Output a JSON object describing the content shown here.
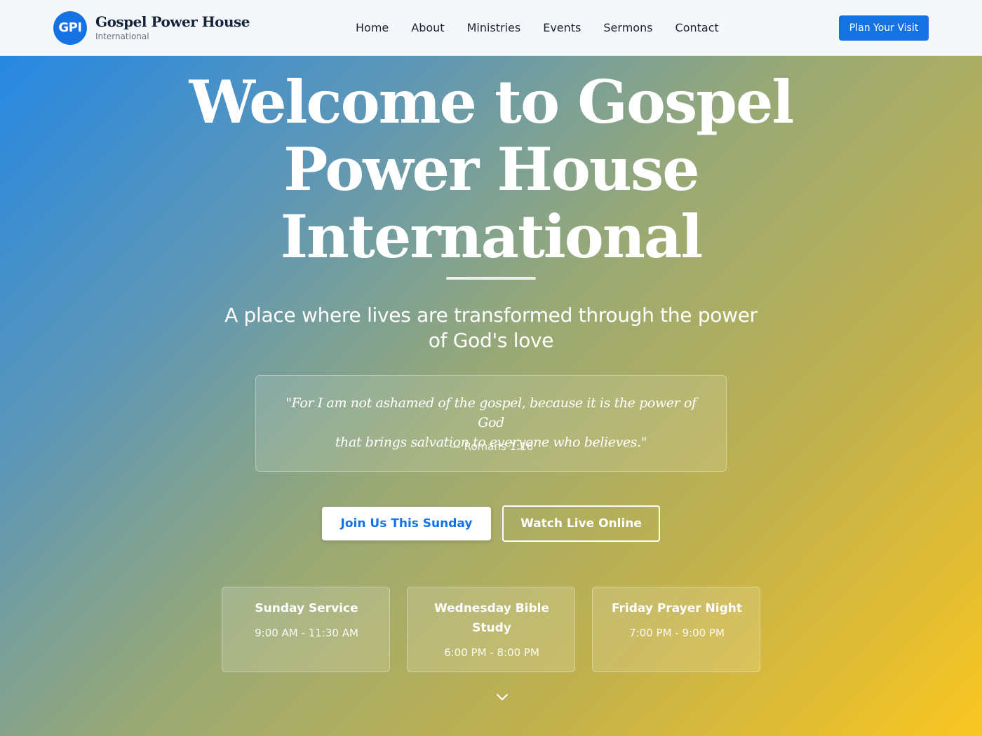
{
  "header": {
    "logo_text": "GPI",
    "brand_name": "Gospel Power House",
    "brand_sub": "International",
    "nav": [
      "Home",
      "About",
      "Ministries",
      "Events",
      "Sermons",
      "Contact"
    ],
    "cta_label": "Plan Your Visit"
  },
  "hero": {
    "title_line1": "Welcome to Gospel",
    "title_line2": "Power House",
    "title_line3": "International",
    "subtitle_line1": "A place where lives are transformed through the power",
    "subtitle_line2": "of God's love",
    "verse": {
      "line1": "\"For I am not ashamed of the gospel, because it is the power of God",
      "line2": "that brings salvation to everyone who believes.\"",
      "reference": "— Romans 1:16"
    },
    "primary_button": "Join Us This Sunday",
    "secondary_button": "Watch Live Online",
    "services": [
      {
        "name": "Sunday Service",
        "time": "9:00 AM - 11:30 AM"
      },
      {
        "name": "Wednesday Bible Study",
        "time": "6:00 PM - 8:00 PM"
      },
      {
        "name": "Friday Prayer Night",
        "time": "7:00 PM - 9:00 PM"
      }
    ],
    "scroll_icon": "chevron-down-icon"
  },
  "colors": {
    "brand_blue": "#1672e3",
    "gradient_start": "#1f86e8",
    "gradient_end": "#fac620",
    "navbar_bg": "#f5f8fb"
  }
}
